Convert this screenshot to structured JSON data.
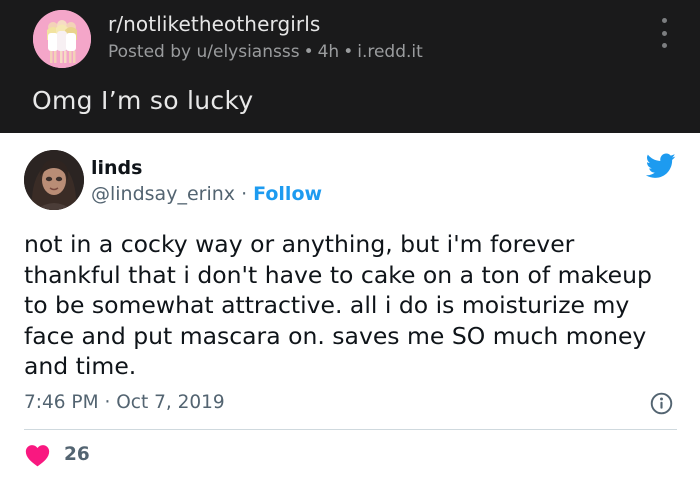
{
  "reddit": {
    "subreddit": "r/notliketheothergirls",
    "posted_by": "Posted by u/elysiansss",
    "age": "4h",
    "source": "i.redd.it",
    "title": "Omg I’m so lucky",
    "colors": {
      "background": "#1a1a1b",
      "avatar_bg": "#f4a6c9"
    }
  },
  "tweet": {
    "display_name": "linds",
    "handle": "@lindsay_erinx",
    "separator": "·",
    "follow_label": "Follow",
    "text": "not in a cocky way or anything, but i'm forever thankful that i don't have to cake on a ton of makeup to be somewhat attractive. all i do is moisturize my face and put mascara on. saves me SO much money and time.",
    "time": "7:46 PM",
    "date": "Oct 7, 2019",
    "like_count": "26",
    "icons": [
      "twitter-bird-icon",
      "info-icon",
      "heart-icon"
    ],
    "colors": {
      "accent": "#1d9bf0",
      "like": "#f91880",
      "secondary_text": "#536471"
    }
  }
}
